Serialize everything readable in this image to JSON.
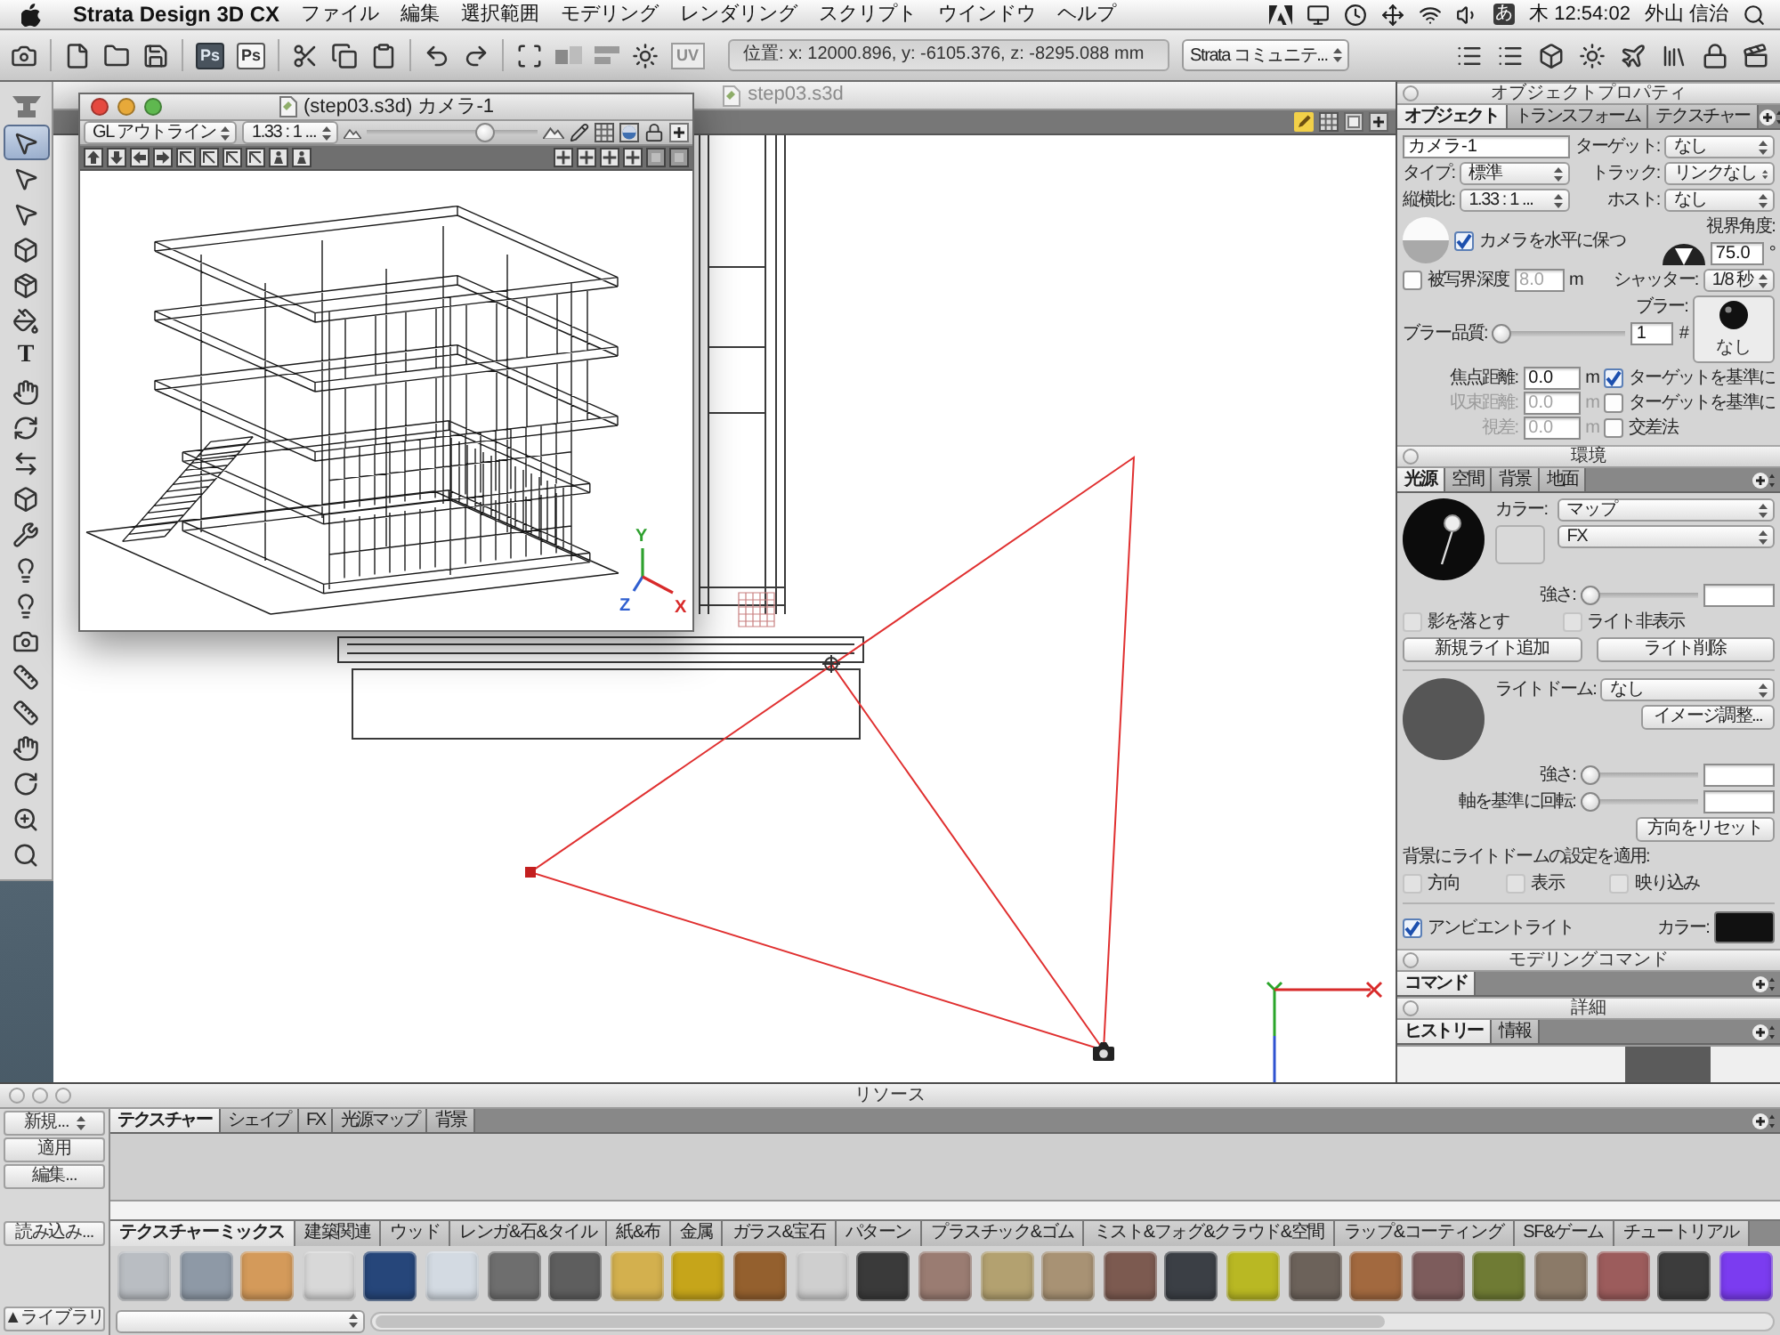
{
  "menu_bar": {
    "app_name": "Strata Design 3D CX",
    "menus": [
      "ファイル",
      "編集",
      "選択範囲",
      "モデリング",
      "レンダリング",
      "スクリプト",
      "ウインドウ",
      "ヘルプ"
    ],
    "input_mode": "あ",
    "clock": "木 12:54:02",
    "user": "外山 信治"
  },
  "toolbar": {
    "text_buttons": [
      "Ps",
      "Ps",
      "UV"
    ],
    "position": "位置: x: 12000.896, y: -6105.376, z: -8295.088 mm",
    "community": "Strata コミュニテ..."
  },
  "tools": [
    {
      "kind": "anvil",
      "selected": false
    },
    {
      "kind": "pointer",
      "selected": true
    },
    {
      "kind": "pointer",
      "selected": false
    },
    {
      "kind": "pointer",
      "selected": false
    },
    {
      "kind": "cube",
      "selected": false
    },
    {
      "kind": "package",
      "selected": false
    },
    {
      "kind": "bucket",
      "selected": false
    },
    {
      "kind": "letter",
      "label": "T",
      "selected": false
    },
    {
      "kind": "hand",
      "selected": false
    },
    {
      "kind": "loop",
      "selected": false
    },
    {
      "kind": "mirror",
      "selected": false
    },
    {
      "kind": "cube",
      "selected": false
    },
    {
      "kind": "wrench",
      "selected": false
    },
    {
      "kind": "bulb",
      "selected": false
    },
    {
      "kind": "bulb",
      "selected": false
    },
    {
      "kind": "camera",
      "selected": false
    },
    {
      "kind": "ruler",
      "selected": false
    },
    {
      "kind": "ruler",
      "selected": false
    },
    {
      "kind": "hand",
      "selected": false
    },
    {
      "kind": "rotate",
      "selected": false
    },
    {
      "kind": "zoom",
      "selected": false
    },
    {
      "kind": "view",
      "selected": false
    }
  ],
  "viewport": {
    "title": "step03.s3d"
  },
  "camera_window": {
    "title": "(step03.s3d) カメラ-1",
    "render_mode": "GL アウトライン",
    "aspect": "1.33 : 1 ...",
    "zoom": {
      "level": 0.72
    },
    "gizmo_labels": [
      "Y",
      "Z",
      "X"
    ]
  },
  "object_properties": {
    "title": "オブジェクトプロパティ",
    "tabs": [
      {
        "label": "オブジェクト",
        "selected": true
      },
      {
        "label": "トランスフォーム",
        "selected": false
      },
      {
        "label": "テクスチャー",
        "selected": false
      }
    ],
    "name": "カメラ-1",
    "target": {
      "label": "ターゲット:",
      "value": "なし"
    },
    "type": {
      "label": "タイプ:",
      "value": "標準"
    },
    "track": {
      "label": "トラック:",
      "value": "リンクなし"
    },
    "aspect": {
      "label": "縦横比:",
      "value": "1.33 : 1 ..."
    },
    "host": {
      "label": "ホスト:",
      "value": "なし"
    },
    "level_camera": {
      "label": "カメラを水平に保つ",
      "checked": true
    },
    "view_angle": {
      "label": "視界角度:",
      "value": "75.0",
      "unit": "°"
    },
    "depth_of_field": {
      "label": "被写界深度",
      "checked": false,
      "value": "8.0",
      "unit": "m"
    },
    "shutter": {
      "label": "シャッター:",
      "value": "1/8 秒"
    },
    "blur": {
      "label": "ブラー:",
      "value": "なし"
    },
    "blur_quality": {
      "label": "ブラー品質:",
      "level": 0,
      "value": "1",
      "unit": "#"
    },
    "distances": [
      {
        "label": "焦点距離:",
        "value": "0.0",
        "unit": "m",
        "disabled": false,
        "option": {
          "label": "ターゲットを基準に",
          "checked": true
        }
      },
      {
        "label": "収束距離:",
        "value": "0.0",
        "unit": "m",
        "disabled": true,
        "option": {
          "label": "ターゲットを基準に",
          "checked": false
        }
      },
      {
        "label": "視差:",
        "value": "0.0",
        "unit": "m",
        "disabled": true,
        "option": {
          "label": "交差法",
          "checked": false
        }
      }
    ]
  },
  "environment": {
    "title": "環境",
    "tabs": [
      {
        "label": "光源",
        "selected": true
      },
      {
        "label": "空間",
        "selected": false
      },
      {
        "label": "背景",
        "selected": false
      },
      {
        "label": "地面",
        "selected": false
      }
    ],
    "color_label": "カラー:",
    "map": "マップ",
    "fx": "FX",
    "intensity": {
      "label": "強さ:",
      "level": 0
    },
    "light_options": [
      {
        "label": "影を落とす",
        "checked": false,
        "disabled": true
      },
      {
        "label": "ライト非表示",
        "checked": false,
        "disabled": true
      }
    ],
    "light_buttons": [
      "新規ライト追加",
      "ライト削除"
    ],
    "light_dome": {
      "label": "ライトドーム:",
      "value": "なし"
    },
    "image_adjust": "イメージ調整...",
    "dome_sliders": [
      {
        "label": "強さ:",
        "level": 0
      },
      {
        "label": "軸を基準に回転:",
        "level": 0
      }
    ],
    "reset_button": "方向をリセット",
    "apply_label": "背景にライトドームの設定を適用:",
    "apply_options": [
      {
        "label": "方向",
        "checked": false,
        "disabled": true
      },
      {
        "label": "表示",
        "checked": false,
        "disabled": true
      },
      {
        "label": "映り込み",
        "checked": false,
        "disabled": true
      }
    ],
    "ambient": {
      "label": "アンビエントライト",
      "checked": true
    },
    "ambient_color_label": "カラー:"
  },
  "modeling_commands": {
    "title": "モデリングコマンド",
    "tabs": [
      {
        "label": "コマンド",
        "selected": true
      }
    ]
  },
  "details": {
    "title": "詳細",
    "tabs": [
      {
        "label": "ヒストリー",
        "selected": true
      },
      {
        "label": "情報",
        "selected": false
      }
    ]
  },
  "resources": {
    "title": "リソース",
    "side_buttons": [
      "新規...",
      "適用",
      "編集..."
    ],
    "import_button": "読み込み...",
    "library_button": "▲ライブラリ",
    "tabs": [
      {
        "label": "テクスチャー",
        "selected": true
      },
      {
        "label": "シェイプ",
        "selected": false
      },
      {
        "label": "FX",
        "selected": false
      },
      {
        "label": "光源マップ",
        "selected": false
      },
      {
        "label": "背景",
        "selected": false
      }
    ],
    "categories": [
      {
        "label": "テクスチャーミックス",
        "selected": true
      },
      {
        "label": "建築関連",
        "selected": false
      },
      {
        "label": "ウッド",
        "selected": false
      },
      {
        "label": "レンガ&石&タイル",
        "selected": false
      },
      {
        "label": "紙&布",
        "selected": false
      },
      {
        "label": "金属",
        "selected": false
      },
      {
        "label": "ガラス&宝石",
        "selected": false
      },
      {
        "label": "パターン",
        "selected": false
      },
      {
        "label": "プラスチック&ゴム",
        "selected": false
      },
      {
        "label": "ミスト&フォグ&クラウド&空間",
        "selected": false
      },
      {
        "label": "ラップ&コーティング",
        "selected": false
      },
      {
        "label": "SF&ゲーム",
        "selected": false
      },
      {
        "label": "チュートリアル",
        "selected": false
      }
    ],
    "swatches": [
      {
        "color": "#b9bdc2"
      },
      {
        "color": "#8e99a6"
      },
      {
        "color": "#d49a5a"
      },
      {
        "color": "#d8d8d8"
      },
      {
        "color": "#26467a"
      },
      {
        "color": "#d3dae2"
      },
      {
        "color": "#6e6e6e"
      },
      {
        "color": "#5e5e5e"
      },
      {
        "color": "#d3b04e"
      },
      {
        "color": "#c6a51a"
      },
      {
        "color": "#94602e"
      },
      {
        "color": "#cfcfcf"
      },
      {
        "color": "#3a3a3a"
      },
      {
        "color": "#9a7c72"
      },
      {
        "color": "#b3a170"
      },
      {
        "color": "#a89274"
      },
      {
        "color": "#7c5a50"
      },
      {
        "color": "#3b3f45"
      },
      {
        "color": "#b9b823"
      },
      {
        "color": "#6c625a"
      },
      {
        "color": "#a2693f"
      },
      {
        "color": "#7d5c5c"
      },
      {
        "color": "#6f7b34"
      },
      {
        "color": "#8b7a68"
      },
      {
        "color": "#9c5c5c"
      },
      {
        "color": "#3c3c3c"
      },
      {
        "color": "#7b3cf0"
      }
    ]
  }
}
